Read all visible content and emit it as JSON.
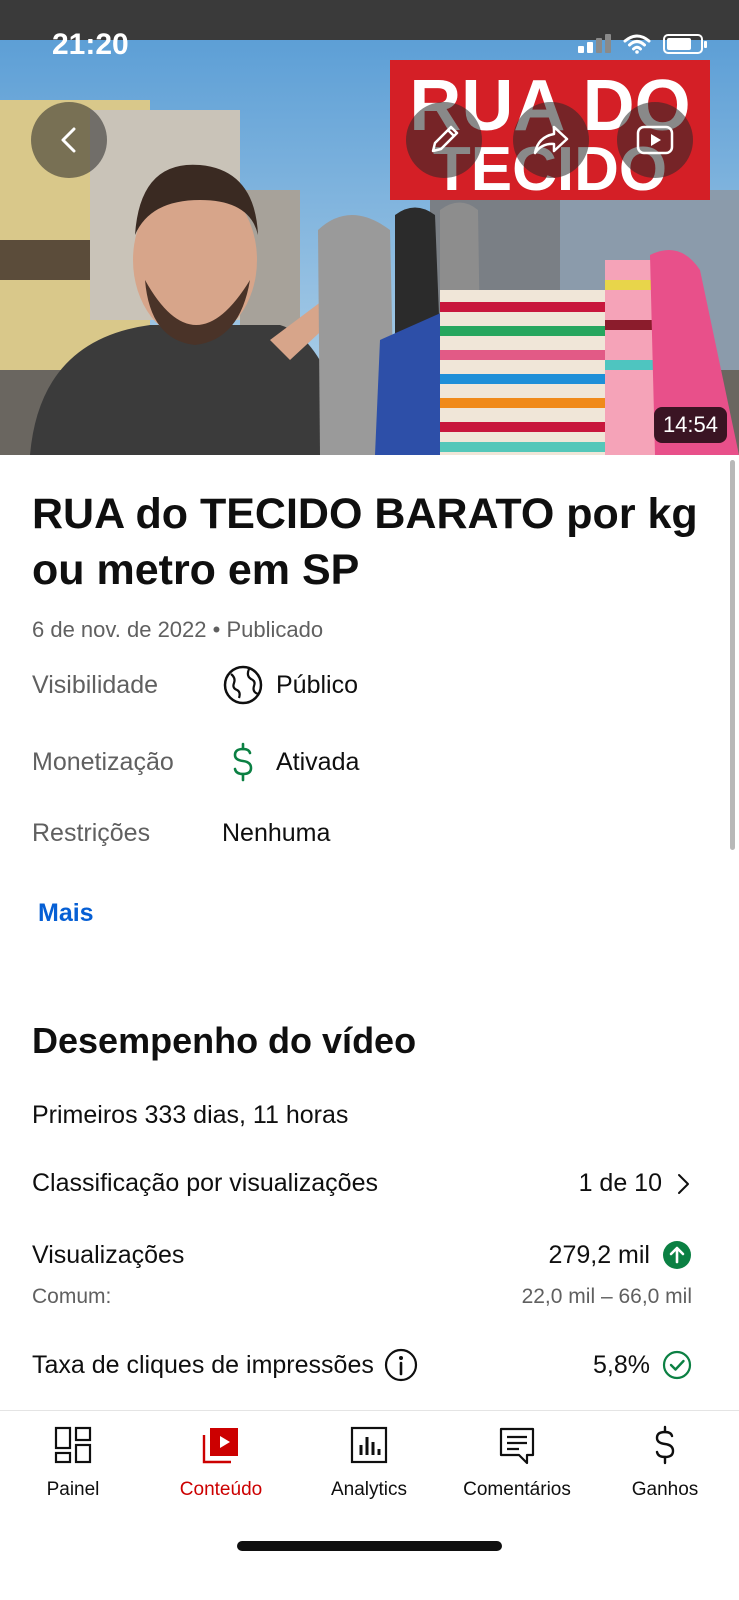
{
  "status_bar": {
    "time": "21:20"
  },
  "video": {
    "thumbnail_text": "RUA DO TECIDO",
    "duration": "14:54",
    "title": "RUA do TECIDO BARATO por kg ou metro em SP",
    "meta": "6 de nov. de 2022 • Publicado"
  },
  "details": {
    "visibility_label": "Visibilidade",
    "visibility_value": "Público",
    "monetization_label": "Monetização",
    "monetization_value": "Ativada",
    "restrictions_label": "Restrições",
    "restrictions_value": "Nenhuma",
    "more_label": "Mais"
  },
  "performance": {
    "title": "Desempenho do vídeo",
    "period": "Primeiros 333 dias, 11 horas",
    "ranking_label": "Classificação por visualizações",
    "ranking_value": "1 de 10",
    "views_label": "Visualizações",
    "views_value": "279,2 mil",
    "typical_label": "Comum:",
    "typical_range": "22,0 mil – 66,0 mil",
    "ctr_label": "Taxa de cliques de impressões",
    "ctr_value": "5,8%"
  },
  "nav": {
    "items": [
      {
        "label": "Painel",
        "icon": "dashboard-icon"
      },
      {
        "label": "Conteúdo",
        "icon": "content-icon",
        "active": true
      },
      {
        "label": "Analytics",
        "icon": "analytics-icon"
      },
      {
        "label": "Comentários",
        "icon": "comments-icon"
      },
      {
        "label": "Ganhos",
        "icon": "earnings-icon"
      }
    ]
  },
  "colors": {
    "accent_red": "#cc0000",
    "link_blue": "#065fd4",
    "positive_green": "#0b8043",
    "secondary_text": "#606060"
  }
}
